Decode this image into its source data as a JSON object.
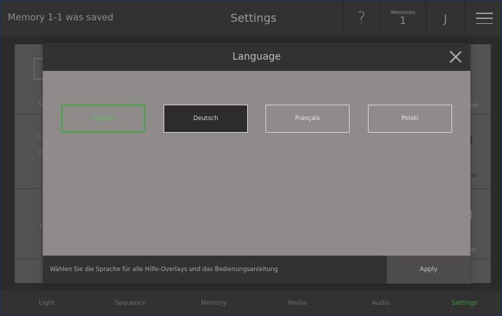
{
  "topbar": {
    "status_text": "Memory 1-1 was saved",
    "title": "Settings",
    "help_label": "?",
    "memories_label": "Memories",
    "memories_count": "1",
    "user_initial": "J"
  },
  "dialog": {
    "title": "Language",
    "languages": [
      {
        "label": "English",
        "selected": true
      },
      {
        "label": "Deutsch",
        "selected": false
      },
      {
        "label": "Français",
        "selected": false
      },
      {
        "label": "Polski",
        "selected": false
      }
    ],
    "footer_text": "Wählen Sie die Sprache für alle Hilfe-Overlays und das Bedienungsanleitung",
    "apply_label": "Apply"
  },
  "background": {
    "row1_left": "C",
    "row1_right": "ole",
    "row2_left": "C",
    "row2_right": "able",
    "row3_left": "(",
    "row3_right": "ple"
  },
  "bottom_nav": [
    {
      "label": "Light",
      "active": false
    },
    {
      "label": "Sequence",
      "active": false
    },
    {
      "label": "Memory",
      "active": false
    },
    {
      "label": "Media",
      "active": false
    },
    {
      "label": "Audio",
      "active": false
    },
    {
      "label": "Settings",
      "active": true
    }
  ],
  "colors": {
    "accent_green": "#46a546",
    "topbar_bg": "#333233",
    "dialog_bg": "#8f8b8a"
  }
}
